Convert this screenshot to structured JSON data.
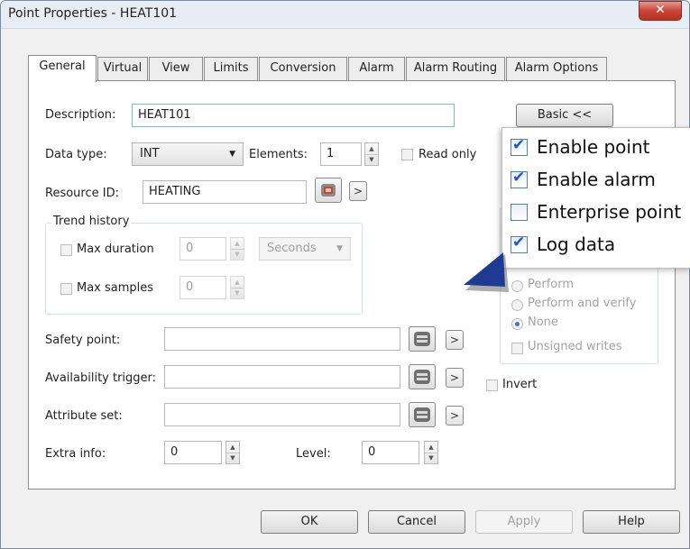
{
  "window": {
    "title": "Point Properties - HEAT101",
    "close_glyph": "✕"
  },
  "tabs": [
    {
      "label": "General"
    },
    {
      "label": "Virtual"
    },
    {
      "label": "View"
    },
    {
      "label": "Limits"
    },
    {
      "label": "Conversion"
    },
    {
      "label": "Alarm"
    },
    {
      "label": "Alarm Routing"
    },
    {
      "label": "Alarm Options"
    }
  ],
  "general": {
    "description_label": "Description:",
    "description_value": "HEAT101",
    "data_type_label": "Data type:",
    "data_type_value": "INT",
    "elements_label": "Elements:",
    "elements_value": "1",
    "read_only_label": "Read only",
    "resource_id_label": "Resource ID:",
    "resource_id_value": "HEATING",
    "basic_button": "Basic <<",
    "trend_history": {
      "title": "Trend history",
      "max_duration_label": "Max duration",
      "max_duration_value": "0",
      "duration_unit": "Seconds",
      "max_samples_label": "Max samples",
      "max_samples_value": "0"
    },
    "safety_point_label": "Safety point:",
    "availability_trigger_label": "Availability trigger:",
    "invert_label": "Invert",
    "attribute_set_label": "Attribute set:",
    "extra_info_label": "Extra info:",
    "extra_info_value": "0",
    "level_label": "Level:",
    "level_value": "0",
    "write_options": {
      "perform": "Perform",
      "perform_and_verify": "Perform and verify",
      "none": "None",
      "selected": "None",
      "unsigned_writes": "Unsigned writes"
    }
  },
  "popup": {
    "items": [
      {
        "label": "Enable point",
        "checked": true
      },
      {
        "label": "Enable alarm",
        "checked": true
      },
      {
        "label": "Enterprise point",
        "checked": false
      },
      {
        "label": "Log data",
        "checked": true
      }
    ]
  },
  "footer": {
    "ok": "OK",
    "cancel": "Cancel",
    "apply": "Apply",
    "help": "Help"
  },
  "colors": {
    "accent": "#2156c4",
    "close_button": "#c9453a",
    "arrow": "#1f3a93"
  }
}
